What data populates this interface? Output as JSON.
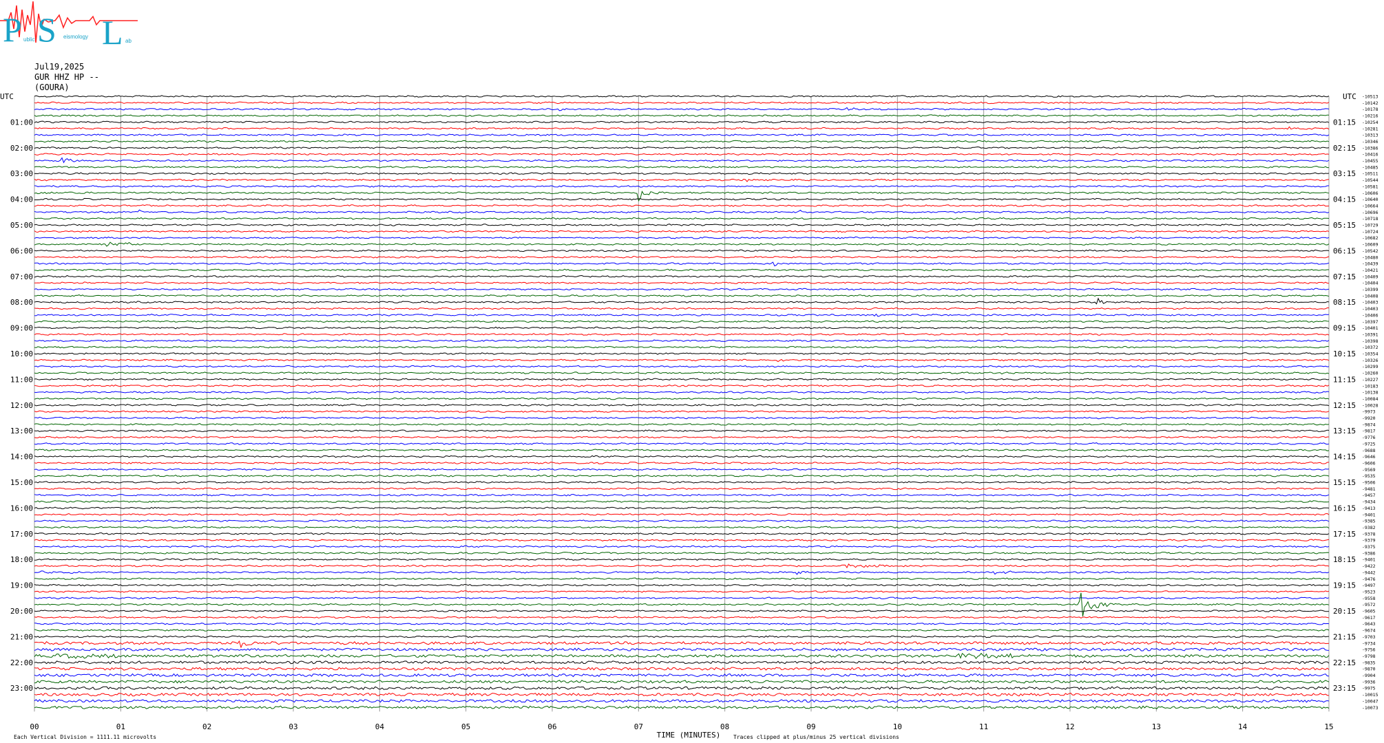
{
  "header": {
    "date": "Jul19,2025",
    "station_line": "GUR HHZ HP --",
    "station_name": "(GOURA)"
  },
  "logo": {
    "letters": [
      "P",
      "S",
      "L"
    ],
    "small_words": [
      "ublic",
      "eismology",
      "ab"
    ],
    "colors": {
      "letters": "#1aa3c8",
      "wave": "#ff2020"
    }
  },
  "chart_data": {
    "type": "line",
    "title": "",
    "xlabel": "TIME (MINUTES)",
    "xlim": [
      0,
      15
    ],
    "x_ticks": [
      "00",
      "01",
      "02",
      "03",
      "04",
      "05",
      "06",
      "07",
      "08",
      "09",
      "10",
      "11",
      "12",
      "13",
      "14",
      "15"
    ],
    "left_axis_label": "UTC",
    "right_axis_label": "UTC",
    "left_ticks": [
      "01:00",
      "02:00",
      "03:00",
      "04:00",
      "05:00",
      "06:00",
      "07:00",
      "08:00",
      "09:00",
      "10:00",
      "11:00",
      "12:00",
      "13:00",
      "14:00",
      "15:00",
      "16:00",
      "17:00",
      "18:00",
      "19:00",
      "20:00",
      "21:00",
      "22:00",
      "23:00"
    ],
    "right_ticks": [
      "01:15",
      "02:15",
      "03:15",
      "04:15",
      "05:15",
      "06:15",
      "07:15",
      "08:15",
      "09:15",
      "10:15",
      "11:15",
      "12:15",
      "13:15",
      "14:15",
      "15:15",
      "16:15",
      "17:15",
      "18:15",
      "19:15",
      "20:15",
      "21:15",
      "22:15",
      "23:15"
    ],
    "trace_colors": [
      "#000000",
      "#ff0000",
      "#0000ff",
      "#006400"
    ],
    "trace_count": 96,
    "minutes_per_trace": 15,
    "right_values": [
      "-10513",
      "-10142",
      "-10178",
      "-10216",
      "-10254",
      "-10281",
      "-10313",
      "-10346",
      "-10386",
      "-10416",
      "-10455",
      "-10485",
      "-10511",
      "-10544",
      "-10581",
      "-10606",
      "-10640",
      "-10664",
      "-10696",
      "-10718",
      "-10729",
      "-10724",
      "-10682",
      "-10609",
      "-10542",
      "-10480",
      "-10439",
      "-10421",
      "-10409",
      "-10404",
      "-10399",
      "-10408",
      "-10403",
      "-10403",
      "-10406",
      "-10397",
      "-10401",
      "-10391",
      "-10398",
      "-10372",
      "-10354",
      "-10326",
      "-10299",
      "-10260",
      "-10227",
      "-10183",
      "-10138",
      "-10084",
      "-10028",
      "-9973",
      "-9920",
      "-9874",
      "-9817",
      "-9776",
      "-9725",
      "-9688",
      "-9646",
      "-9606",
      "-9569",
      "-9535",
      "-9506",
      "-9481",
      "-9457",
      "-9434",
      "-9413",
      "-9401",
      "-9385",
      "-9382",
      "-9378",
      "-9379",
      "-9375",
      "-9386",
      "-9401",
      "-9422",
      "-9442",
      "-9476",
      "-9497",
      "-9523",
      "-9558",
      "-9572",
      "-9605",
      "-9617",
      "-9643",
      "-9674",
      "-9703",
      "-9734",
      "-9756",
      "-9798",
      "-9835",
      "-9870",
      "-9904",
      "-9936",
      "-9975",
      "-10015",
      "-10047",
      "-10073"
    ],
    "events": [
      {
        "trace": 2,
        "minute": 6.05,
        "duration": 0.45,
        "amp": 3
      },
      {
        "trace": 2,
        "minute": 9.4,
        "duration": 0.3,
        "amp": 4
      },
      {
        "trace": 2,
        "minute": 7.7,
        "duration": 0.3,
        "amp": 2
      },
      {
        "trace": 5,
        "minute": 14.5,
        "duration": 0.6,
        "amp": 3
      },
      {
        "trace": 10,
        "minute": 0.3,
        "duration": 0.35,
        "amp": 6
      },
      {
        "trace": 13,
        "minute": 4.8,
        "duration": 0.3,
        "amp": 3
      },
      {
        "trace": 13,
        "minute": 8.2,
        "duration": 0.25,
        "amp": 4
      },
      {
        "trace": 15,
        "minute": 0.0,
        "duration": 0.7,
        "amp": 3
      },
      {
        "trace": 15,
        "minute": 6.97,
        "duration": 0.35,
        "amp": 18
      },
      {
        "trace": 18,
        "minute": 1.2,
        "duration": 0.25,
        "amp": 4
      },
      {
        "trace": 18,
        "minute": 8.85,
        "duration": 0.5,
        "amp": 4
      },
      {
        "trace": 22,
        "minute": 9.5,
        "duration": 0.15,
        "amp": 3
      },
      {
        "trace": 23,
        "minute": 0.75,
        "duration": 1.2,
        "amp": 5
      },
      {
        "trace": 26,
        "minute": 8.55,
        "duration": 0.25,
        "amp": 8
      },
      {
        "trace": 32,
        "minute": 12.3,
        "duration": 0.35,
        "amp": 8
      },
      {
        "trace": 34,
        "minute": 9.7,
        "duration": 0.5,
        "amp": 3
      },
      {
        "trace": 41,
        "minute": 8.6,
        "duration": 0.45,
        "amp": 3
      },
      {
        "trace": 43,
        "minute": 11.15,
        "duration": 0.5,
        "amp": 5
      },
      {
        "trace": 74,
        "minute": 11.1,
        "duration": 0.8,
        "amp": 4
      },
      {
        "trace": 73,
        "minute": 9.3,
        "duration": 1.9,
        "amp": 4
      },
      {
        "trace": 74,
        "minute": 0.0,
        "duration": 1.0,
        "amp": 3
      },
      {
        "trace": 74,
        "minute": 8.8,
        "duration": 0.4,
        "amp": 4
      },
      {
        "trace": 79,
        "minute": 12.1,
        "duration": 0.5,
        "amp": 28
      },
      {
        "trace": 85,
        "minute": 2.35,
        "duration": 0.5,
        "amp": 11
      },
      {
        "trace": 87,
        "minute": 10.6,
        "duration": 2.5,
        "amp": 6
      },
      {
        "trace": 86,
        "minute": 13.4,
        "duration": 1.6,
        "amp": 3
      },
      {
        "trace": 87,
        "minute": 0.2,
        "duration": 2.5,
        "amp": 4
      }
    ],
    "footer_left": "Each Vertical Division = 1111.11 microvolts",
    "footer_right": "Traces clipped at plus/minus 25 vertical divisions"
  }
}
